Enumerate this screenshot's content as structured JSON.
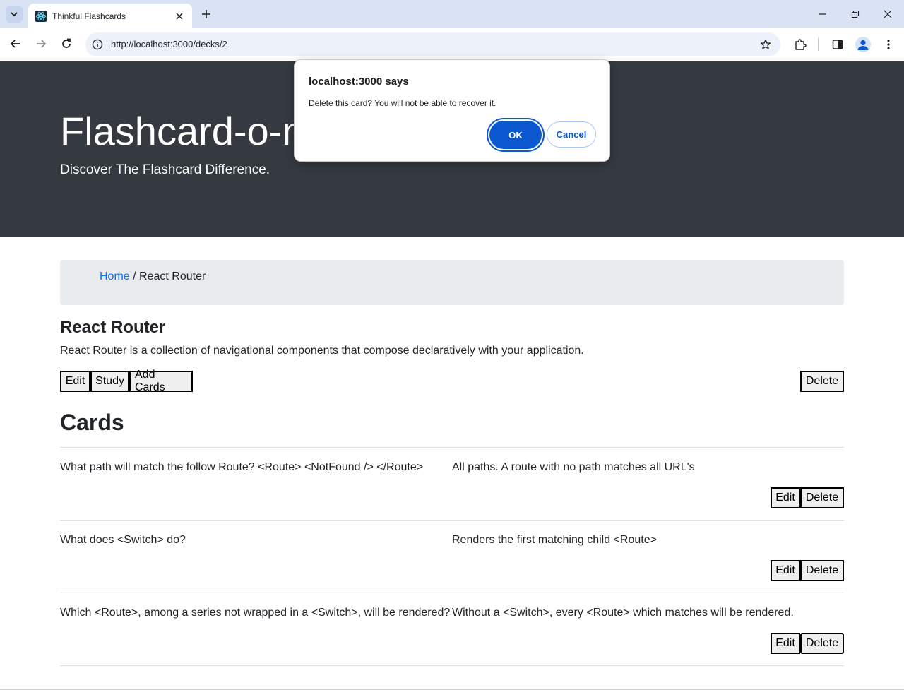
{
  "browser": {
    "tab_title": "Thinkful Flashcards",
    "url": "http://localhost:3000/decks/2"
  },
  "page": {
    "brand_title": "Flashcard-o-m",
    "brand_subtitle": "Discover The Flashcard Difference.",
    "breadcrumb": {
      "home": "Home",
      "separator": " / ",
      "current": "React Router"
    },
    "deck": {
      "name": "React Router",
      "description": "React Router is a collection of navigational components that compose declaratively with your application.",
      "buttons": {
        "edit": "Edit",
        "study": "Study",
        "add_cards": "Add Cards",
        "delete": "Delete"
      }
    },
    "cards_heading": "Cards",
    "cards": [
      {
        "front": "What path will match the follow Route? <Route> <NotFound /> </Route>",
        "back": "All paths. A route with no path matches all URL's",
        "edit": "Edit",
        "delete": "Delete"
      },
      {
        "front": "What does <Switch> do?",
        "back": "Renders the first matching child <Route>",
        "edit": "Edit",
        "delete": "Delete"
      },
      {
        "front": "Which <Route>, among a series not wrapped in a <Switch>, will be rendered?",
        "back": "Without a <Switch>, every <Route> which matches will be rendered.",
        "edit": "Edit",
        "delete": "Delete"
      }
    ]
  },
  "dialog": {
    "title": "localhost:3000 says",
    "message": "Delete this card? You will not be able to recover it.",
    "ok": "OK",
    "cancel": "Cancel"
  },
  "colors": {
    "jumbotron": "#343a40",
    "breadcrumb_bg": "#e9ecef",
    "link": "#0d6efd",
    "dialog_ok": "#0b57d0"
  }
}
